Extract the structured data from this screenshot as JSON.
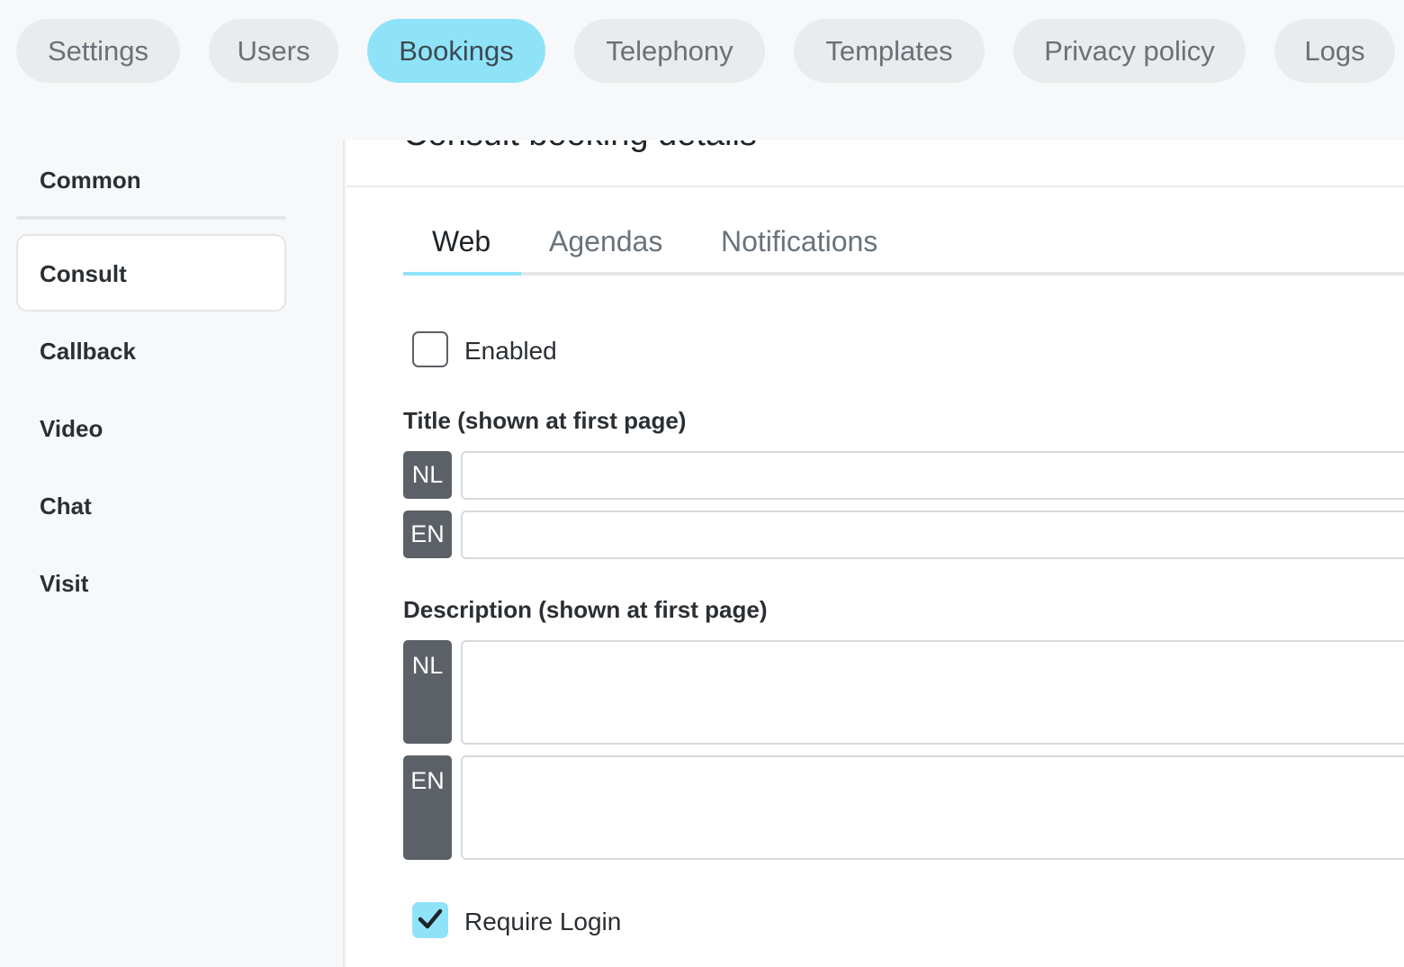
{
  "topnav": {
    "items": [
      {
        "label": "Settings",
        "active": false
      },
      {
        "label": "Users",
        "active": false
      },
      {
        "label": "Bookings",
        "active": true
      },
      {
        "label": "Telephony",
        "active": false
      },
      {
        "label": "Templates",
        "active": false
      },
      {
        "label": "Privacy policy",
        "active": false
      },
      {
        "label": "Logs",
        "active": false
      }
    ]
  },
  "sidebar": {
    "items": [
      {
        "label": "Common"
      },
      {
        "label": "Consult",
        "active": true
      },
      {
        "label": "Callback"
      },
      {
        "label": "Video"
      },
      {
        "label": "Chat"
      },
      {
        "label": "Visit"
      }
    ]
  },
  "main": {
    "heading": "Consult booking details",
    "tabs": [
      {
        "label": "Web",
        "active": true
      },
      {
        "label": "Agendas"
      },
      {
        "label": "Notifications"
      }
    ],
    "enabled": {
      "label": "Enabled",
      "checked": false
    },
    "title_field": {
      "label": "Title (shown at first page)",
      "languages": [
        {
          "code": "NL",
          "value": ""
        },
        {
          "code": "EN",
          "value": ""
        }
      ]
    },
    "description_field": {
      "label": "Description (shown at first page)",
      "languages": [
        {
          "code": "NL",
          "value": ""
        },
        {
          "code": "EN",
          "value": ""
        }
      ]
    },
    "require_login": {
      "label": "Require Login",
      "checked": true
    }
  },
  "colors": {
    "accent": "#8fe3f9",
    "pill_inactive": "#e9ebed",
    "badge": "#5c6167"
  }
}
